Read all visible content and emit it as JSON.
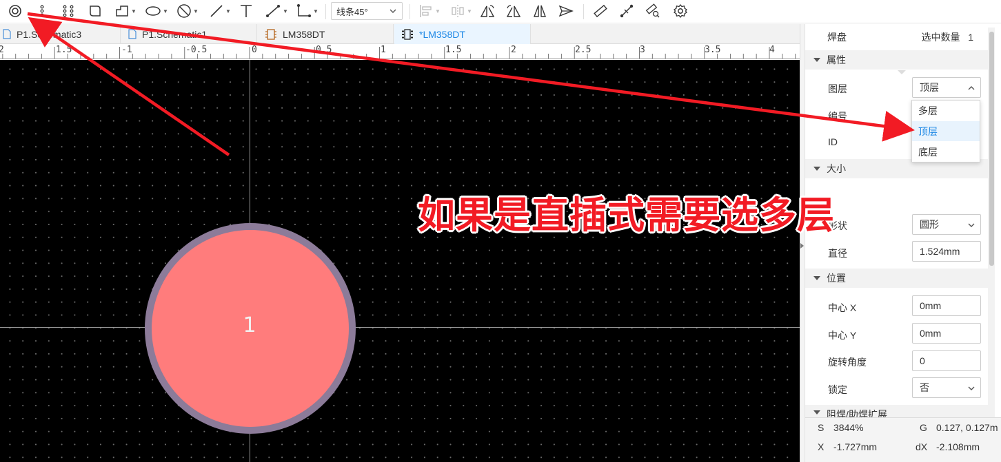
{
  "toolbar": {
    "line_mode": "线条45°",
    "tools": [
      "pad-tool",
      "via-tool",
      "pad-array-tool",
      "rect-tool",
      "polygon-tool",
      "ellipse-tool",
      "circle-tool",
      "line-tool",
      "text-tool",
      "dimension-tool",
      "angle-tool",
      "align-tool",
      "distribute-tool",
      "flip-h-tool",
      "flip-v-tool",
      "mirror-tool",
      "send-tool",
      "measure-tool",
      "route-tool",
      "search-tool",
      "settings-tool"
    ]
  },
  "tabs": [
    {
      "label": "P1.Schematic3",
      "icon": "document-icon",
      "active": false
    },
    {
      "label": "P1.Schematic1",
      "icon": "document-icon",
      "active": false
    },
    {
      "label": "LM358DT",
      "icon": "chip-icon",
      "active": false
    },
    {
      "label": "*LM358DT",
      "icon": "footprint-icon",
      "active": true
    }
  ],
  "ruler": {
    "labels": [
      "2",
      "1.5",
      "-1",
      "-0.5",
      "0",
      "0.5",
      "1",
      "1.5",
      "2",
      "2.5",
      "3",
      "3.5",
      "4"
    ]
  },
  "canvas": {
    "pad_number": "1",
    "colors": {
      "background": "#000000",
      "pad": "#ff7c7c",
      "pad_ring": "#8c7b99"
    }
  },
  "panel": {
    "title": "焊盘",
    "count_label": "选中数量",
    "count": "1",
    "sections": {
      "properties": "属性",
      "size": "大小",
      "position": "位置",
      "mask": "阻焊/助焊扩展"
    },
    "fields": {
      "layer_label": "图层",
      "layer_value": "顶层",
      "number_label": "编号",
      "id_label": "ID",
      "shape_label": "形状",
      "shape_value": "圆形",
      "diameter_label": "直径",
      "diameter_value": "1.524mm",
      "center_x_label": "中心 X",
      "center_x_value": "0mm",
      "center_y_label": "中心 Y",
      "center_y_value": "0mm",
      "rotation_label": "旋转角度",
      "rotation_value": "0",
      "lock_label": "锁定",
      "lock_value": "否"
    },
    "layer_options": [
      "多层",
      "顶层",
      "底层"
    ],
    "layer_selected": "顶层"
  },
  "status": {
    "s_label": "S",
    "s_value": "3844%",
    "g_label": "G",
    "g_value": "0.127, 0.127m",
    "x_label": "X",
    "x_value": "-1.727mm",
    "dx_label": "dX",
    "dx_value": "-2.108mm"
  },
  "annotation": {
    "text": "如果是直插式需要选多层",
    "color": "#f21b24"
  }
}
